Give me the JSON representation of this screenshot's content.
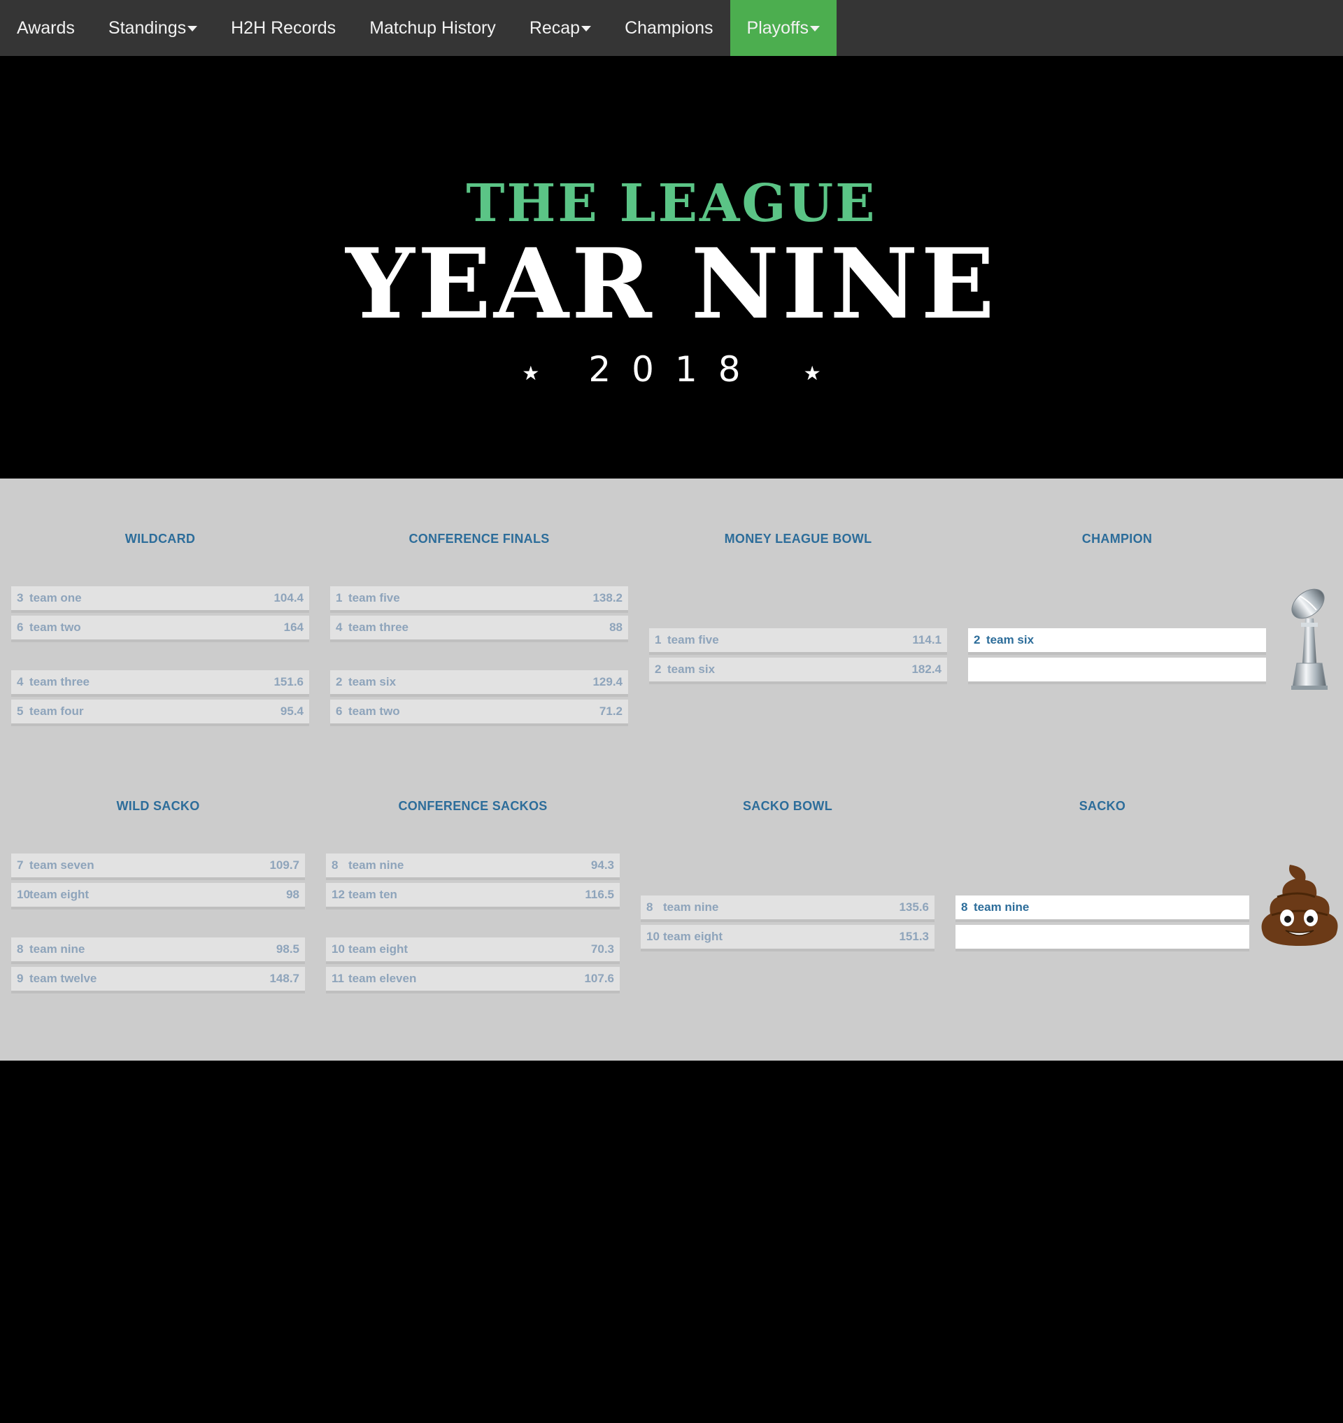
{
  "nav": {
    "items": [
      {
        "label": "Awards",
        "caret": false,
        "active": false
      },
      {
        "label": "Standings",
        "caret": true,
        "active": false
      },
      {
        "label": "H2H Records",
        "caret": false,
        "active": false
      },
      {
        "label": "Matchup History",
        "caret": false,
        "active": false
      },
      {
        "label": "Recap",
        "caret": true,
        "active": false
      },
      {
        "label": "Champions",
        "caret": false,
        "active": false
      },
      {
        "label": "Playoffs",
        "caret": true,
        "active": true
      }
    ],
    "active_color": "#4cae4f"
  },
  "hero": {
    "subtitle": "THE LEAGUE",
    "title": "YEAR NINE",
    "year": "2018",
    "star_left": "★",
    "star_right": "★"
  },
  "winners_bracket": {
    "rounds": [
      {
        "title": "WILDCARD"
      },
      {
        "title": "CONFERENCE FINALS"
      },
      {
        "title": "MONEY LEAGUE BOWL"
      },
      {
        "title": "CHAMPION"
      }
    ],
    "wildcard": [
      [
        {
          "seed": "3",
          "name": "team one",
          "score": "104.4"
        },
        {
          "seed": "6",
          "name": "team two",
          "score": "164"
        }
      ],
      [
        {
          "seed": "4",
          "name": "team three",
          "score": "151.6"
        },
        {
          "seed": "5",
          "name": "team four",
          "score": "95.4"
        }
      ]
    ],
    "conference_finals": [
      [
        {
          "seed": "1",
          "name": "team five",
          "score": "138.2"
        },
        {
          "seed": "4",
          "name": "team three",
          "score": "88"
        }
      ],
      [
        {
          "seed": "2",
          "name": "team six",
          "score": "129.4"
        },
        {
          "seed": "6",
          "name": "team two",
          "score": "71.2"
        }
      ]
    ],
    "final": [
      {
        "seed": "1",
        "name": "team five",
        "score": "114.1"
      },
      {
        "seed": "2",
        "name": "team six",
        "score": "182.4"
      }
    ],
    "champion": {
      "seed": "2",
      "name": "team six"
    }
  },
  "losers_bracket": {
    "rounds": [
      {
        "title": "WILD SACKO"
      },
      {
        "title": "CONFERENCE SACKOS"
      },
      {
        "title": "SACKO BOWL"
      },
      {
        "title": "SACKO"
      }
    ],
    "wild_sacko": [
      [
        {
          "seed": "7",
          "name": "team seven",
          "score": "109.7"
        },
        {
          "seed": "10",
          "name": "team eight",
          "score": "98"
        }
      ],
      [
        {
          "seed": "8",
          "name": "team nine",
          "score": "98.5"
        },
        {
          "seed": "9",
          "name": "team twelve",
          "score": "148.7"
        }
      ]
    ],
    "conference_sackos": [
      [
        {
          "seed": "8",
          "name": "team nine",
          "score": "94.3"
        },
        {
          "seed": "12",
          "name": "team ten",
          "score": "116.5"
        }
      ],
      [
        {
          "seed": "10",
          "name": "team eight",
          "score": "70.3"
        },
        {
          "seed": "11",
          "name": "team eleven",
          "score": "107.6"
        }
      ]
    ],
    "final": [
      {
        "seed": "8",
        "name": "team nine",
        "score": "135.6"
      },
      {
        "seed": "10",
        "name": "team eight",
        "score": "151.3"
      }
    ],
    "sacko": {
      "seed": "8",
      "name": "team nine"
    }
  },
  "colors": {
    "nav_bg": "#353535",
    "hero_green": "#5bc486",
    "bracket_bg": "#cccccc",
    "round_title": "#2d6d9a",
    "team_text": "#8ea4bb"
  },
  "icons": {
    "champion": "trophy-icon",
    "sacko": "poop-emoji-icon"
  }
}
